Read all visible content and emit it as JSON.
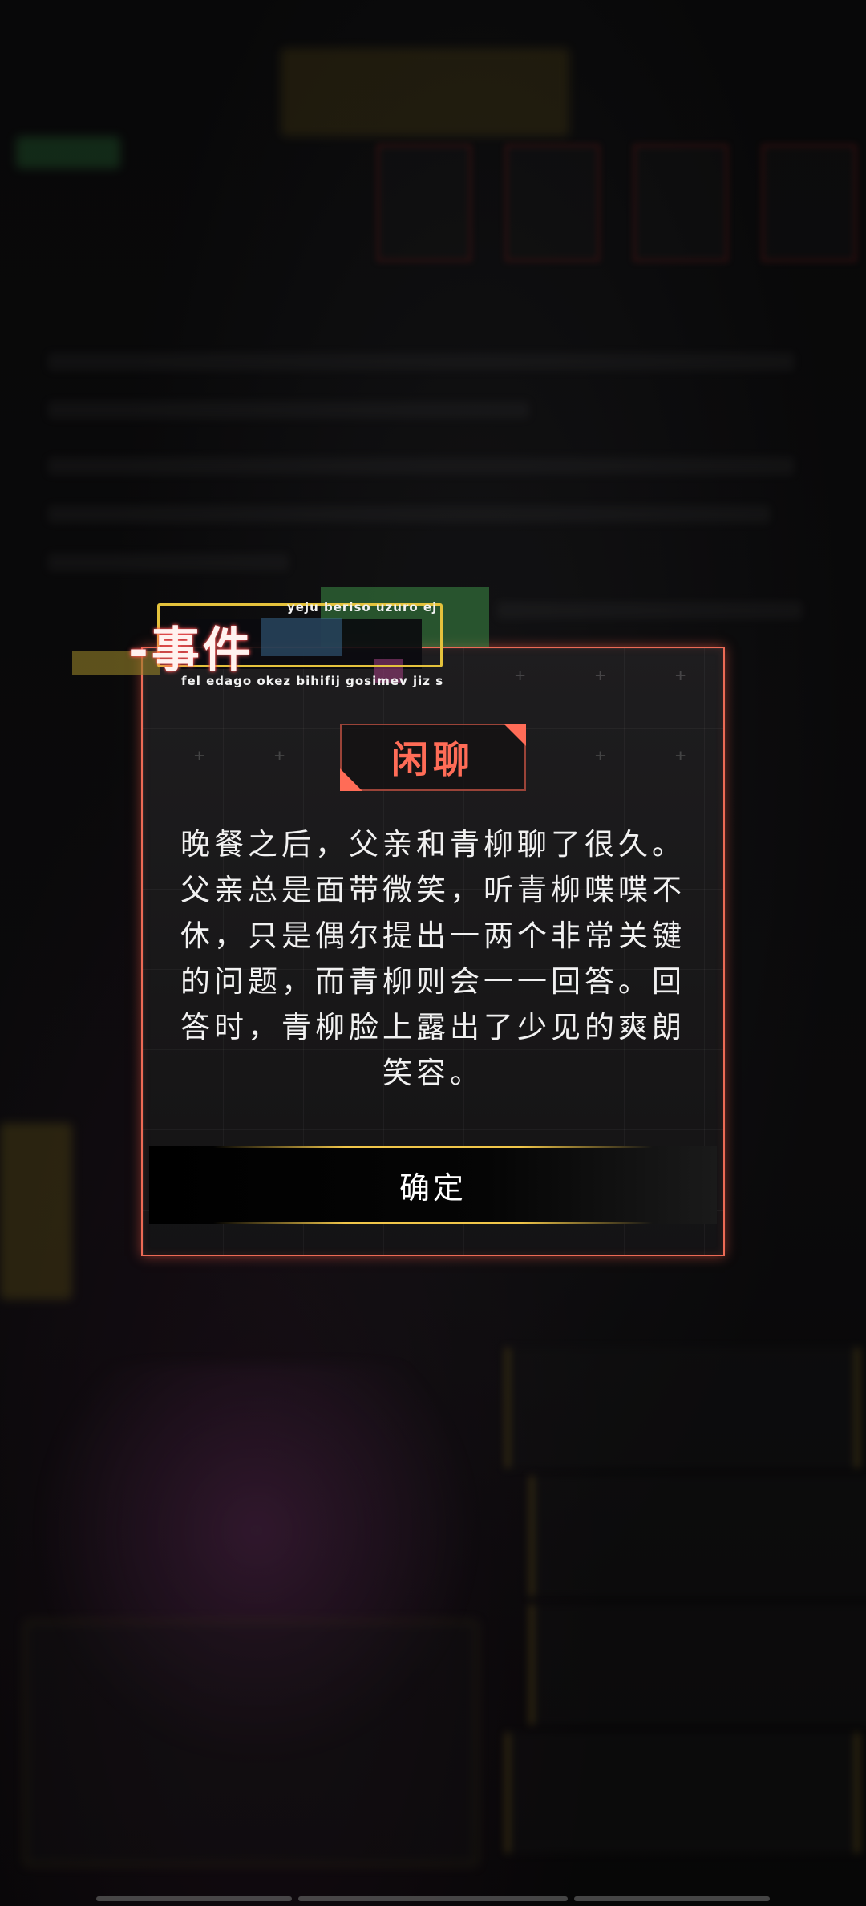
{
  "event_dialog": {
    "header_title": "-事件",
    "header_subtitle_top": "yeju beriso uzuro ej",
    "header_subtitle_bottom": "fel edago okez bihifij gosimev jiz s",
    "tag": "闲聊",
    "body_text": "晚餐之后，父亲和青柳聊了很久。父亲总是面带微笑，听青柳喋喋不休，只是偶尔提出一两个非常关键的问题，而青柳则会一一回答。回答时，青柳脸上露出了少见的爽朗笑容。",
    "confirm_label": "确定"
  },
  "colors": {
    "accent_red": "#ff6c57",
    "frame_red": "#ec6a55",
    "gold": "#f0c64a",
    "text": "#f1f1f1"
  }
}
